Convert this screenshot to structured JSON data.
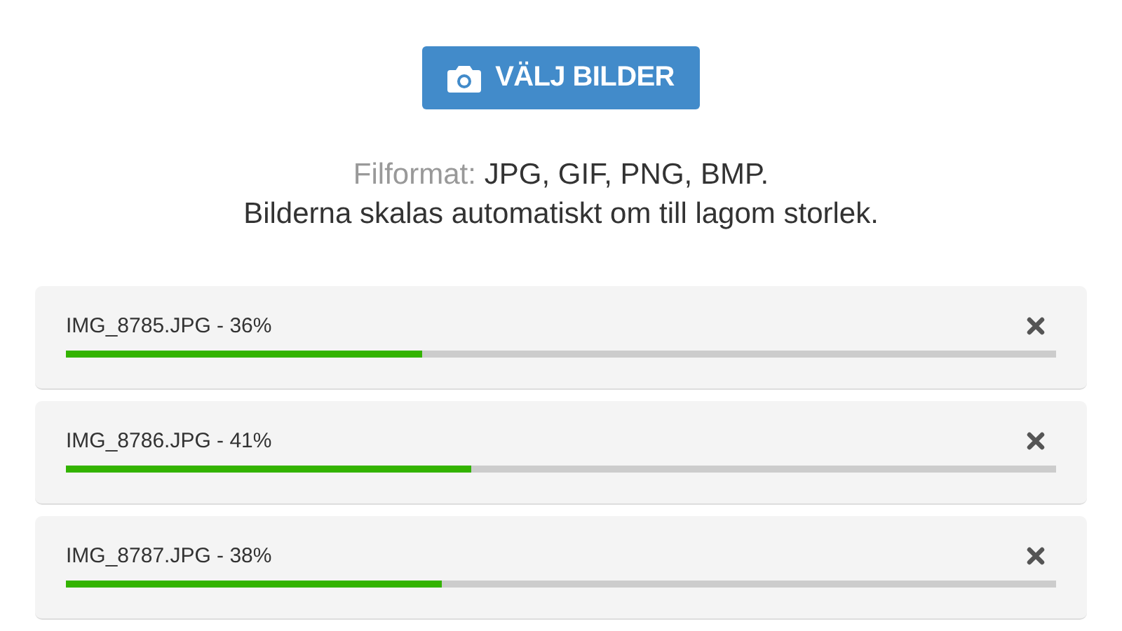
{
  "upload_button": {
    "label": "VÄLJ BILDER"
  },
  "info": {
    "format_label": "Filformat:",
    "format_value": "JPG, GIF, PNG, BMP.",
    "note": "Bilderna skalas automatiskt om till lagom storlek."
  },
  "uploads": [
    {
      "label": "IMG_8785.JPG - 36%",
      "level": 0.36
    },
    {
      "label": "IMG_8786.JPG - 41%",
      "level": 0.41
    },
    {
      "label": "IMG_8787.JPG - 38%",
      "level": 0.38
    }
  ]
}
